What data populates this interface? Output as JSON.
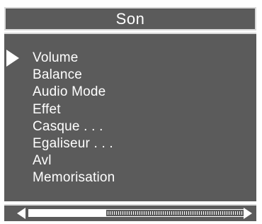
{
  "menu": {
    "title": "Son",
    "selected_index": 0,
    "items": [
      {
        "label": "Volume"
      },
      {
        "label": "Balance"
      },
      {
        "label": "Audio Mode"
      },
      {
        "label": "Effet"
      },
      {
        "label": "Casque . . ."
      },
      {
        "label": "Egaliseur . . ."
      },
      {
        "label": "Avl"
      },
      {
        "label": "Memorisation"
      }
    ]
  },
  "slider": {
    "value_fraction": 0.36
  },
  "colors": {
    "panel_background": "#5b5b5b",
    "text": "#ffffff",
    "border": "#d9d9d9"
  },
  "icons": {
    "selector": "play-arrow-right-icon",
    "slider_left": "arrow-left-icon",
    "slider_right": "arrow-right-icon"
  }
}
